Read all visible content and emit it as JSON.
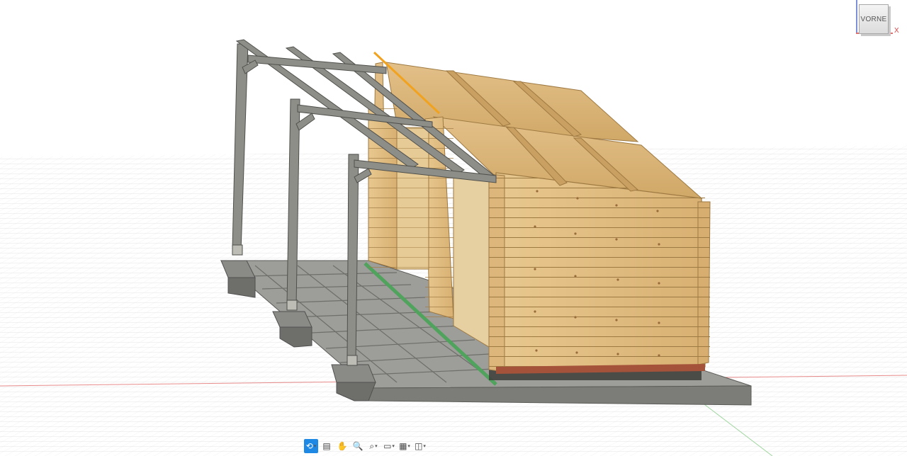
{
  "viewcube": {
    "face_label": "VORNE",
    "axis_x_label": "X"
  },
  "toolbar": {
    "items": [
      {
        "name": "orbit-tool-button",
        "icon": "orbit-icon",
        "glyph": "⟲",
        "active": true,
        "dropdown": true
      },
      {
        "name": "look-at-button",
        "icon": "look-at-icon",
        "glyph": "▤",
        "active": false,
        "dropdown": false
      },
      {
        "name": "pan-button",
        "icon": "hand-icon",
        "glyph": "✋",
        "active": false,
        "dropdown": false
      },
      {
        "name": "zoom-button",
        "icon": "zoom-icon",
        "glyph": "🔍",
        "active": false,
        "dropdown": false
      },
      {
        "name": "fit-button",
        "icon": "zoom-fit-icon",
        "glyph": "⌕",
        "active": false,
        "dropdown": true
      },
      {
        "name": "display-settings-button",
        "icon": "monitor-icon",
        "glyph": "▭",
        "active": false,
        "dropdown": true
      },
      {
        "name": "grid-settings-button",
        "icon": "grid-icon",
        "glyph": "▦",
        "active": false,
        "dropdown": true
      },
      {
        "name": "viewports-button",
        "icon": "viewports-icon",
        "glyph": "◫",
        "active": false,
        "dropdown": true
      }
    ]
  },
  "colors": {
    "wood": "#dcb67d",
    "wood_dark": "#b98f52",
    "steel": "#8c8c86",
    "steel_dark": "#6a6a66",
    "concrete": "#9a9a96",
    "selected_edge": "#f1a21e",
    "green_edge": "#4fa35c",
    "grid": "#d6d6d6",
    "axis_red": "#e25555"
  }
}
